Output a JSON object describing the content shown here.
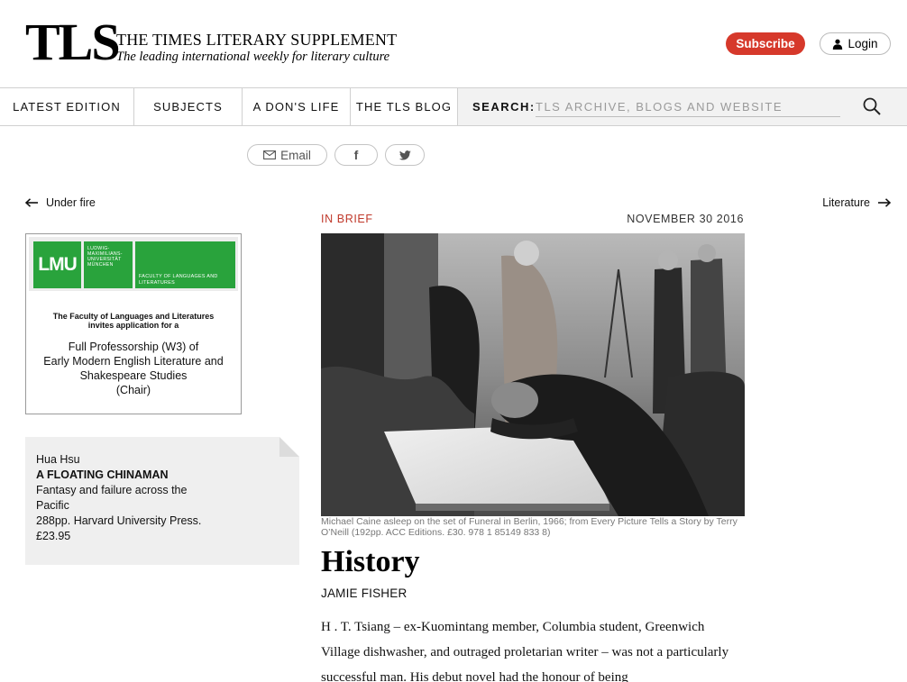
{
  "header": {
    "logo": "TLS",
    "title": "THE TIMES LITERARY SUPPLEMENT",
    "tagline": "The leading international weekly for literary culture",
    "subscribe_label": "Subscribe",
    "login_label": "Login"
  },
  "nav": {
    "items": [
      {
        "label": "LATEST EDITION"
      },
      {
        "label": "SUBJECTS"
      },
      {
        "label": "A DON'S LIFE"
      },
      {
        "label": "THE TLS BLOG"
      }
    ],
    "search_label": "SEARCH:",
    "search_placeholder": "TLS ARCHIVE, BLOGS AND WEBSITE"
  },
  "share": {
    "email_label": "Email",
    "facebook_glyph": "f"
  },
  "pager": {
    "prev_label": "Under fire",
    "next_label": "Literature"
  },
  "ad": {
    "lmu": "LMU",
    "university": "LUDWIG-MAXIMILIANS-UNIVERSITÄT MÜNCHEN",
    "faculty_badge": "FACULTY OF LANGUAGES AND LITERATURES",
    "intro_line1": "The Faculty of Languages and Literatures",
    "intro_line2": "invites application for a",
    "position_line1": "Full Professorship (W3) of",
    "position_line2": "Early Modern English Literature and",
    "position_line3": "Shakespeare Studies",
    "position_line4": "(Chair)"
  },
  "book": {
    "author": "Hua Hsu",
    "title": "A FLOATING CHINAMAN",
    "subtitle": "Fantasy and failure across the Pacific",
    "details": "288pp. Harvard University Press.",
    "price": "£23.95"
  },
  "article": {
    "category": "IN BRIEF",
    "date": "NOVEMBER 30 2016",
    "caption": "Michael Caine asleep on the set of Funeral in Berlin, 1966; from Every Picture Tells a Story by Terry O’Neill (192pp. ACC Editions. £30. 978 1 85149 833 8)",
    "headline": "History",
    "author": "JAMIE FISHER",
    "body": "H . T. Tsiang – ex-Kuomintang member, Columbia student, Greenwich Village dishwasher, and outraged proletarian writer – was not a particularly successful man. His debut novel had the honour of being"
  }
}
